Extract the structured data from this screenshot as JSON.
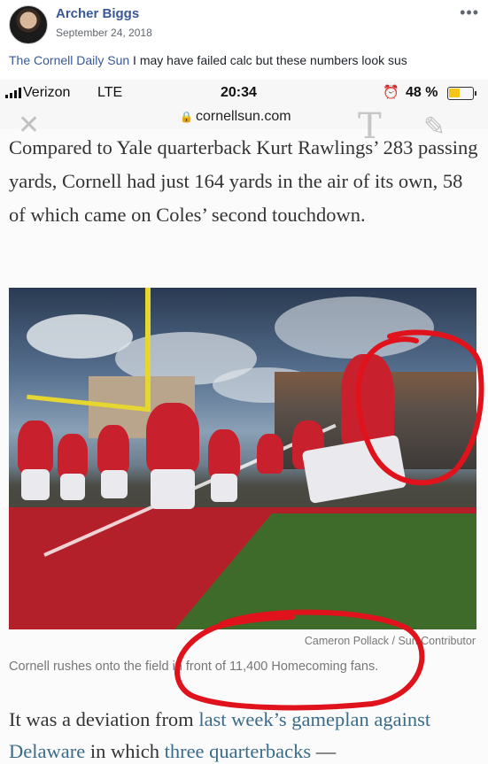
{
  "post": {
    "author": "Archer Biggs",
    "date": "September 24, 2018",
    "more_label": "•••",
    "caption_page": "The Cornell Daily Sun",
    "caption_text": " I may have failed calc but these numbers look sus"
  },
  "status_bar": {
    "carrier": "Verizon",
    "network": "LTE",
    "time": "20:34",
    "alarm_icon": "alarm-clock-icon",
    "battery_text": "48 %",
    "battery_level": 0.48,
    "battery_color": "#f5c518"
  },
  "browser": {
    "url": "cornellsun.com",
    "lock_icon": "lock-icon"
  },
  "article": {
    "paragraph1": "Compared to Yale quarterback Kurt Rawlings’ 283 passing yards, Cornell had just 164 yards in the air of its own, 58 of which came on Coles’ second touchdown.",
    "photo_credit": "Cameron Pollack / Sun Contributor",
    "photo_caption": "Cornell rushes onto the field in front of 11,400 Homecoming fans.",
    "paragraph2_start": "It was a deviation from ",
    "paragraph2_link1": "last week’s gameplan against Delaware",
    "paragraph2_mid": " in which ",
    "paragraph2_link2": "three quarterbacks",
    "paragraph2_end": " —"
  },
  "colors": {
    "link": "#385898",
    "annotation": "#e0121b",
    "article_link": "#3a6c8a"
  }
}
